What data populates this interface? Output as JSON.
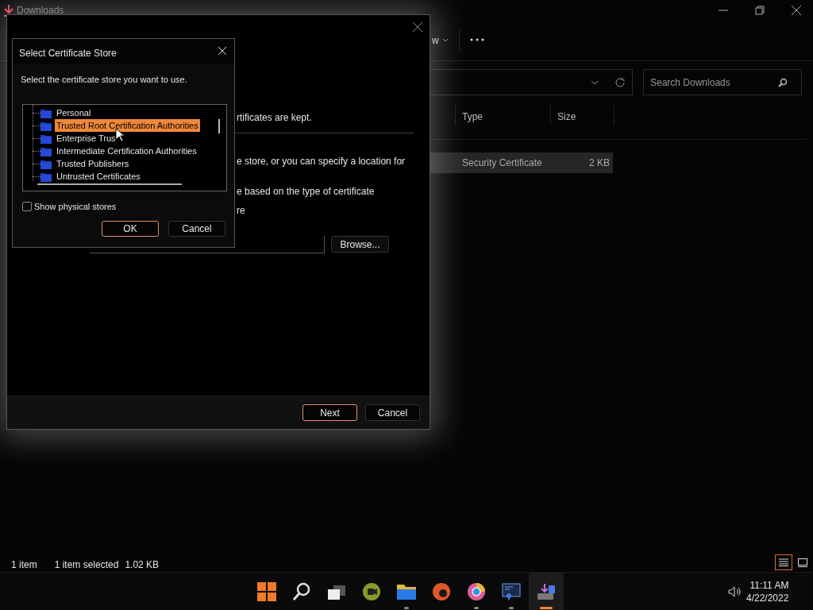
{
  "explorer": {
    "title": "Downloads",
    "toolbar_partial": "w",
    "search": {
      "placeholder": "Search Downloads"
    },
    "columns": [
      "Type",
      "Size"
    ],
    "rows": [
      {
        "type": "Security Certificate",
        "size": "2 KB",
        "selected": true
      }
    ],
    "status_bar": [
      "1 item",
      "1 item selected",
      "1.02 KB"
    ],
    "views": [
      {
        "kind": "details",
        "selected": true
      },
      {
        "kind": "tiles",
        "selected": false
      }
    ]
  },
  "wizard": {
    "lines": [
      "rtificates are kept.",
      "e store, or you can specify a location for",
      "e based on the type of certificate",
      "re"
    ],
    "browse_button": "Browse...",
    "buttons": [
      {
        "label": "Next",
        "default": true
      },
      {
        "label": "Cancel",
        "default": false
      }
    ]
  },
  "store_dialog": {
    "title": "Select Certificate Store",
    "prompt": "Select the certificate store you want to use.",
    "items": [
      {
        "label": "Personal",
        "selected": false
      },
      {
        "label": "Trusted Root Certification Authorities",
        "selected": true
      },
      {
        "label": "Enterprise Trus",
        "selected": false
      },
      {
        "label": "Intermediate Certification Authorities",
        "selected": false
      },
      {
        "label": "Trusted Publishers",
        "selected": false
      },
      {
        "label": "Untrusted Certificates",
        "selected": false
      }
    ],
    "checkbox": {
      "label": "Show physical stores",
      "checked": false
    },
    "buttons": [
      {
        "label": "OK",
        "default": true
      },
      {
        "label": "Cancel",
        "default": false
      }
    ]
  },
  "taskbar": {
    "apps": [
      {
        "kind": "start",
        "running": false,
        "active": false
      },
      {
        "kind": "search",
        "running": false,
        "active": false
      },
      {
        "kind": "taskview",
        "running": false,
        "active": false
      },
      {
        "kind": "chat",
        "running": false,
        "active": false
      },
      {
        "kind": "folder",
        "running": true,
        "active": false
      },
      {
        "kind": "edge",
        "running": false,
        "active": false
      },
      {
        "kind": "chrome",
        "running": true,
        "active": false
      },
      {
        "kind": "app",
        "running": true,
        "active": false
      },
      {
        "kind": "installer",
        "running": true,
        "active": true
      }
    ],
    "time": "11:11 AM",
    "date": "4/22/2022"
  }
}
